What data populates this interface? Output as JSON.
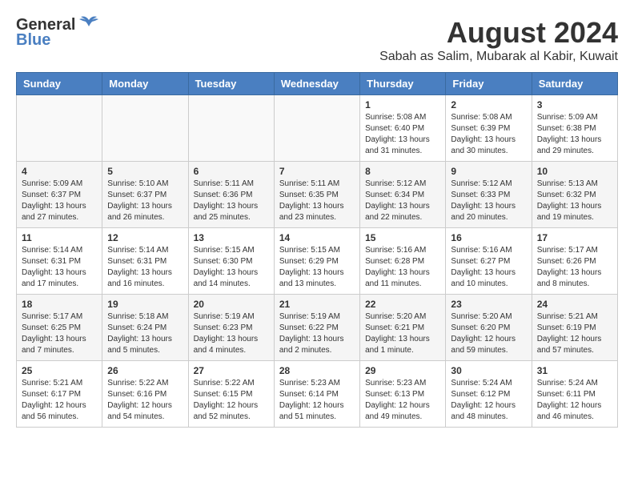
{
  "header": {
    "logo_general": "General",
    "logo_blue": "Blue",
    "month_title": "August 2024",
    "subtitle": "Sabah as Salim, Mubarak al Kabir, Kuwait"
  },
  "weekdays": [
    "Sunday",
    "Monday",
    "Tuesday",
    "Wednesday",
    "Thursday",
    "Friday",
    "Saturday"
  ],
  "weeks": [
    [
      {
        "day": "",
        "info": ""
      },
      {
        "day": "",
        "info": ""
      },
      {
        "day": "",
        "info": ""
      },
      {
        "day": "",
        "info": ""
      },
      {
        "day": "1",
        "info": "Sunrise: 5:08 AM\nSunset: 6:40 PM\nDaylight: 13 hours\nand 31 minutes."
      },
      {
        "day": "2",
        "info": "Sunrise: 5:08 AM\nSunset: 6:39 PM\nDaylight: 13 hours\nand 30 minutes."
      },
      {
        "day": "3",
        "info": "Sunrise: 5:09 AM\nSunset: 6:38 PM\nDaylight: 13 hours\nand 29 minutes."
      }
    ],
    [
      {
        "day": "4",
        "info": "Sunrise: 5:09 AM\nSunset: 6:37 PM\nDaylight: 13 hours\nand 27 minutes."
      },
      {
        "day": "5",
        "info": "Sunrise: 5:10 AM\nSunset: 6:37 PM\nDaylight: 13 hours\nand 26 minutes."
      },
      {
        "day": "6",
        "info": "Sunrise: 5:11 AM\nSunset: 6:36 PM\nDaylight: 13 hours\nand 25 minutes."
      },
      {
        "day": "7",
        "info": "Sunrise: 5:11 AM\nSunset: 6:35 PM\nDaylight: 13 hours\nand 23 minutes."
      },
      {
        "day": "8",
        "info": "Sunrise: 5:12 AM\nSunset: 6:34 PM\nDaylight: 13 hours\nand 22 minutes."
      },
      {
        "day": "9",
        "info": "Sunrise: 5:12 AM\nSunset: 6:33 PM\nDaylight: 13 hours\nand 20 minutes."
      },
      {
        "day": "10",
        "info": "Sunrise: 5:13 AM\nSunset: 6:32 PM\nDaylight: 13 hours\nand 19 minutes."
      }
    ],
    [
      {
        "day": "11",
        "info": "Sunrise: 5:14 AM\nSunset: 6:31 PM\nDaylight: 13 hours\nand 17 minutes."
      },
      {
        "day": "12",
        "info": "Sunrise: 5:14 AM\nSunset: 6:31 PM\nDaylight: 13 hours\nand 16 minutes."
      },
      {
        "day": "13",
        "info": "Sunrise: 5:15 AM\nSunset: 6:30 PM\nDaylight: 13 hours\nand 14 minutes."
      },
      {
        "day": "14",
        "info": "Sunrise: 5:15 AM\nSunset: 6:29 PM\nDaylight: 13 hours\nand 13 minutes."
      },
      {
        "day": "15",
        "info": "Sunrise: 5:16 AM\nSunset: 6:28 PM\nDaylight: 13 hours\nand 11 minutes."
      },
      {
        "day": "16",
        "info": "Sunrise: 5:16 AM\nSunset: 6:27 PM\nDaylight: 13 hours\nand 10 minutes."
      },
      {
        "day": "17",
        "info": "Sunrise: 5:17 AM\nSunset: 6:26 PM\nDaylight: 13 hours\nand 8 minutes."
      }
    ],
    [
      {
        "day": "18",
        "info": "Sunrise: 5:17 AM\nSunset: 6:25 PM\nDaylight: 13 hours\nand 7 minutes."
      },
      {
        "day": "19",
        "info": "Sunrise: 5:18 AM\nSunset: 6:24 PM\nDaylight: 13 hours\nand 5 minutes."
      },
      {
        "day": "20",
        "info": "Sunrise: 5:19 AM\nSunset: 6:23 PM\nDaylight: 13 hours\nand 4 minutes."
      },
      {
        "day": "21",
        "info": "Sunrise: 5:19 AM\nSunset: 6:22 PM\nDaylight: 13 hours\nand 2 minutes."
      },
      {
        "day": "22",
        "info": "Sunrise: 5:20 AM\nSunset: 6:21 PM\nDaylight: 13 hours\nand 1 minute."
      },
      {
        "day": "23",
        "info": "Sunrise: 5:20 AM\nSunset: 6:20 PM\nDaylight: 12 hours\nand 59 minutes."
      },
      {
        "day": "24",
        "info": "Sunrise: 5:21 AM\nSunset: 6:19 PM\nDaylight: 12 hours\nand 57 minutes."
      }
    ],
    [
      {
        "day": "25",
        "info": "Sunrise: 5:21 AM\nSunset: 6:17 PM\nDaylight: 12 hours\nand 56 minutes."
      },
      {
        "day": "26",
        "info": "Sunrise: 5:22 AM\nSunset: 6:16 PM\nDaylight: 12 hours\nand 54 minutes."
      },
      {
        "day": "27",
        "info": "Sunrise: 5:22 AM\nSunset: 6:15 PM\nDaylight: 12 hours\nand 52 minutes."
      },
      {
        "day": "28",
        "info": "Sunrise: 5:23 AM\nSunset: 6:14 PM\nDaylight: 12 hours\nand 51 minutes."
      },
      {
        "day": "29",
        "info": "Sunrise: 5:23 AM\nSunset: 6:13 PM\nDaylight: 12 hours\nand 49 minutes."
      },
      {
        "day": "30",
        "info": "Sunrise: 5:24 AM\nSunset: 6:12 PM\nDaylight: 12 hours\nand 48 minutes."
      },
      {
        "day": "31",
        "info": "Sunrise: 5:24 AM\nSunset: 6:11 PM\nDaylight: 12 hours\nand 46 minutes."
      }
    ]
  ]
}
